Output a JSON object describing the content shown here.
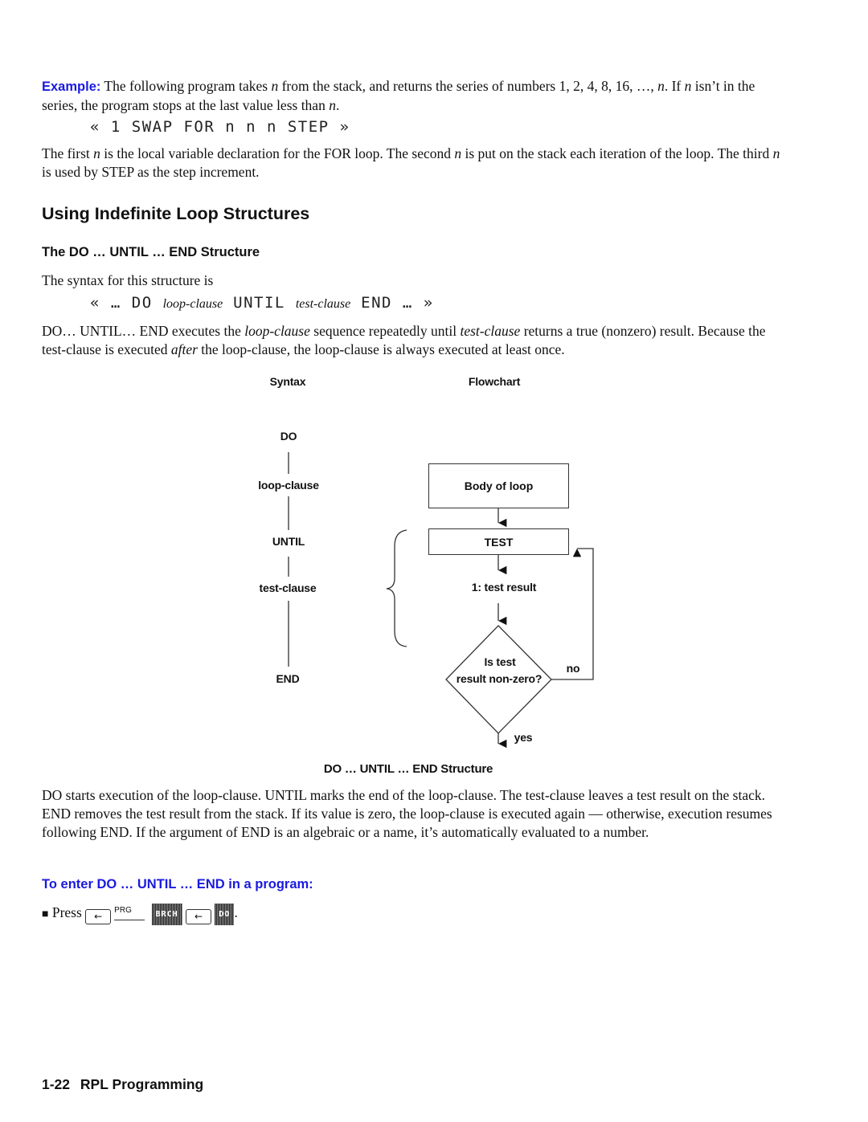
{
  "example": {
    "lead": "Example:",
    "text_parts": [
      " The following program takes ",
      "n",
      " from the stack, and returns the series of numbers 1, 2, 4, 8, 16, …, ",
      "n",
      ". If ",
      "n",
      " isn’t in the series, the program stops at the last value less than ",
      "n",
      "."
    ],
    "code": "« 1 SWAP FOR n n n STEP »",
    "explain_parts": [
      "The first ",
      "n",
      " is the local variable declaration for the FOR loop. The second ",
      "n",
      " is put on the stack each iteration of the loop. The third ",
      "n",
      " is used by STEP as the step increment."
    ]
  },
  "section": {
    "title": "Using Indefinite Loop Structures",
    "subtitle": "The DO … UNTIL … END Structure",
    "syntax_intro": "The syntax for this structure is",
    "syntax": {
      "open": "« … DO ",
      "loop_clause": "loop-clause",
      "until": " UNTIL ",
      "test_clause": "test-clause",
      "end": " END … »"
    },
    "description_parts": [
      "DO… UNTIL… END executes the ",
      "loop-clause",
      " sequence repeatedly until ",
      "test-clause",
      " returns a true (nonzero) result. Because the test-clause is executed ",
      "after",
      " the loop-clause, the loop-clause is always executed at least once."
    ]
  },
  "diagram": {
    "syntax_header": "Syntax",
    "flowchart_header": "Flowchart",
    "syntax_items": [
      "DO",
      "loop-clause",
      "UNTIL",
      "test-clause",
      "END"
    ],
    "body_box": "Body of loop",
    "test_box": "TEST",
    "stack_result": "1: test result",
    "decision_line1": "Is test",
    "decision_line2": "result non-zero?",
    "no_label": "no",
    "yes_label": "yes",
    "caption": "DO … UNTIL … END Structure"
  },
  "body_paragraph": " DO starts execution of the loop-clause. UNTIL marks the end of the loop-clause. The test-clause leaves a test result on the stack. END removes the test result from the stack. If its value is zero, the loop-clause is executed again — otherwise, execution resumes following END. If the argument of END is an algebraic or a name, it’s automatically evaluated to a number.",
  "procedure": {
    "title": "To enter DO … UNTIL … END in a program:",
    "bullet": "■",
    "press": "Press",
    "keys": {
      "left_shift_1": "←",
      "prg_label": "PRG",
      "brch_softkey": "BRCH",
      "left_shift_2": "←",
      "do_softkey": "DO"
    },
    "end_punct": "."
  },
  "footer": {
    "page_number": "1-22",
    "chapter": "RPL Programming"
  }
}
